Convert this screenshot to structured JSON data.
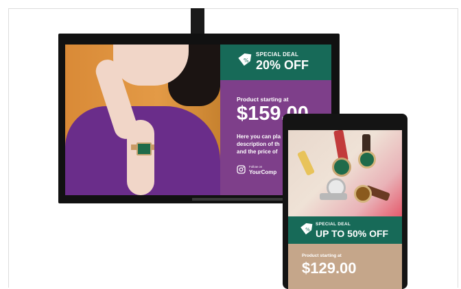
{
  "landscape_display": {
    "deal_label": "SPECIAL DEAL",
    "deal_value": "20% OFF",
    "starting_label": "Product starting at",
    "price": "$159.00",
    "description_lines": [
      "Here you can pla",
      "description of th",
      "and the price of"
    ],
    "follow_label": "Follow on",
    "follow_name": "YourComp"
  },
  "portrait_display": {
    "deal_label": "SPECIAL DEAL",
    "deal_value": "UP TO 50% OFF",
    "starting_label": "Product starting at",
    "price": "$129.00"
  },
  "colors": {
    "banner_green": "#176a58",
    "body_purple": "#7e3f8a",
    "body_tan": "#c5a68a",
    "accent_orange": "#d98a37"
  },
  "icons": [
    "price-tag-icon",
    "instagram-icon"
  ]
}
